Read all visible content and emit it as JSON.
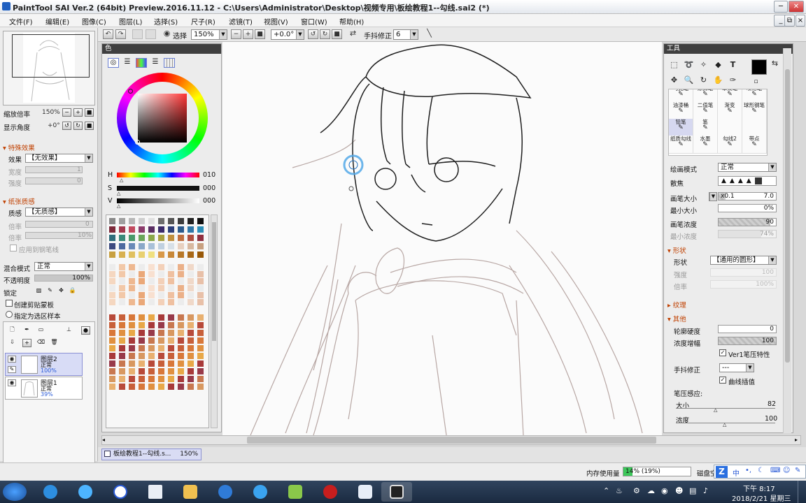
{
  "window": {
    "title": "PaintTool SAI Ver.2 (64bit) Preview.2016.11.12 - C:\\Users\\Administrator\\Desktop\\视频专用\\板绘教程1--勾线.sai2 (*)",
    "minimize": "─",
    "maximize": "□",
    "close": "✕"
  },
  "menubar": {
    "items": [
      "文件(F)",
      "编辑(E)",
      "图像(C)",
      "图层(L)",
      "选择(S)",
      "尺子(R)",
      "滤镜(T)",
      "视图(V)",
      "窗口(W)",
      "帮助(H)"
    ],
    "restore": "⧉"
  },
  "toolbar": {
    "selection_label": "选择",
    "zoom_value": "150%",
    "angle_value": "+0.0°",
    "stabilizer_label": "手抖修正",
    "stabilizer_value": "6"
  },
  "left_panel": {
    "zoom_label": "缩放倍率",
    "zoom_value": "150%",
    "angle_label": "显示角度",
    "angle_value": "+0°",
    "effects_section": "特殊效果",
    "effect_label": "效果",
    "effect_value": "【无效果】",
    "width_label": "宽度",
    "width_value": "1",
    "strength_label": "强度",
    "strength_value": "0",
    "paper_section": "纸张质感",
    "texture_label": "质感",
    "texture_value": "【无质感】",
    "scale_label": "倍率",
    "scale_value": "0",
    "multiplier_label": "倍率",
    "multiplier_value": "10%",
    "apply_brush": "应用到钢笔线",
    "blend_label": "混合模式",
    "blend_value": "正常",
    "opacity_label": "不透明度",
    "opacity_value": "100%",
    "opacity_fraction": 1.0,
    "lock_label": "锁定",
    "clipping_label": "创建剪贴蒙板",
    "selection_source_label": "指定为选区样本",
    "layers": [
      {
        "name": "图层2",
        "mode": "正常",
        "opacity": "100%",
        "selected": true
      },
      {
        "name": "图层1",
        "mode": "正常",
        "opacity": "39%",
        "selected": false
      }
    ]
  },
  "color_panel": {
    "title": "色",
    "h_label": "H",
    "h_value": "010",
    "s_label": "S",
    "s_value": "000",
    "v_label": "V",
    "v_value": "000"
  },
  "tool_panel": {
    "title": "工具",
    "text_tool": "T",
    "brushes": [
      [
        "马克笔",
        "涂抹笔",
        "晕染笔",
        "喷枪笔"
      ],
      [
        "油漆桶",
        "二值笔",
        "渐变",
        "球形钢笔"
      ],
      [
        "铅笔",
        "笔",
        "",
        ""
      ],
      [
        "纸质勾线",
        "水墨",
        "勾线2",
        "带点"
      ]
    ],
    "draw_mode_label": "绘画模式",
    "draw_mode_value": "正常",
    "blur_label": "散焦",
    "size_label": "画笔大小",
    "size_multiplier": "x0.1",
    "size_value": "7.0",
    "size_fraction": 0.12,
    "min_size_label": "最小大小",
    "min_size_value": "0%",
    "min_size_fraction": 0.0,
    "density_label": "画笔浓度",
    "density_value": "90",
    "density_fraction": 0.9,
    "min_density_label": "最小浓度",
    "min_density_value": "74%",
    "min_density_fraction": 0.74,
    "shape_section": "形状",
    "shape_label": "形状",
    "shape_value": "【通用的圆形】",
    "shape_strength_label": "强度",
    "shape_strength_value": "100",
    "shape_scale_label": "倍率",
    "shape_scale_value": "100%",
    "texture_section": "纹理",
    "other_section": "其他",
    "edge_label": "轮廓硬度",
    "edge_value": "0",
    "edge_fraction": 0.0,
    "density_boost_label": "浓度增幅",
    "density_boost_value": "100",
    "density_boost_fraction": 1.0,
    "ver1_label": "Ver1笔压特性",
    "stabilizer_label": "手抖修正",
    "stabilizer_value": "---",
    "curve_label": "曲线插值",
    "pressure_label": "笔压感应:",
    "pressure_size_label": "大小",
    "pressure_size_value": "82",
    "pressure_density_label": "浓度",
    "pressure_density_value": "100"
  },
  "document_tab": {
    "name": "板绘教程1--勾线.s...",
    "zoom": "150%"
  },
  "status": {
    "memory_label": "内存使用量",
    "memory_value": "14% (19%)",
    "memory_fraction": 0.14,
    "disk_label": "磁盘空"
  },
  "ime": {
    "label": "中"
  },
  "taskbar": {
    "time": "下午 8:17",
    "date": "2018/2/21 星期三"
  },
  "colors": {
    "accent_section": "#c04000",
    "selection": "#d8dcf6",
    "taskbar": "#1e3048",
    "line_art": "#202020",
    "sketch": "#b8a7a4"
  }
}
